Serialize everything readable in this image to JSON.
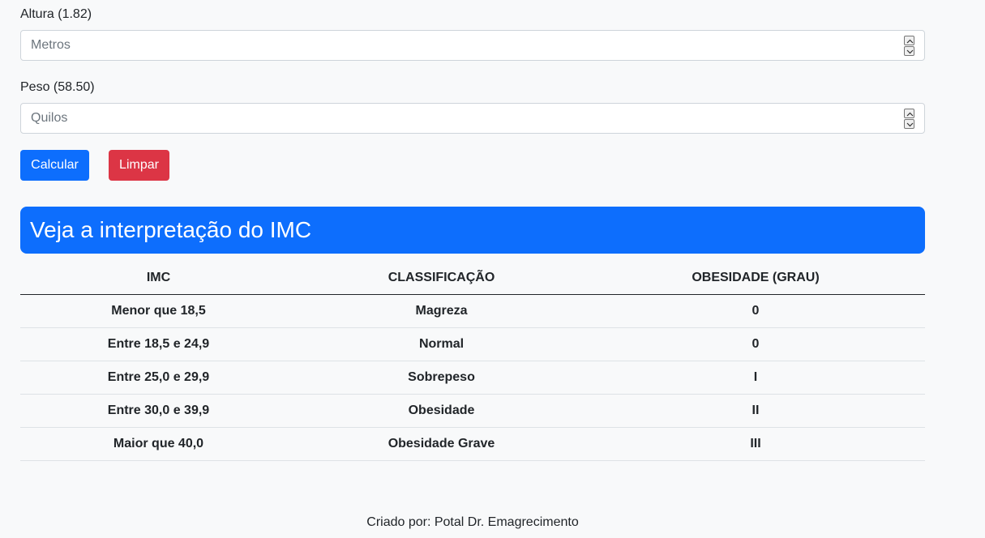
{
  "form": {
    "altura_label": "Altura (1.82)",
    "altura_placeholder": "Metros",
    "peso_label": "Peso (58.50)",
    "peso_placeholder": "Quilos",
    "calcular_label": "Calcular",
    "limpar_label": "Limpar"
  },
  "banner": {
    "title": "Veja a interpretação do IMC"
  },
  "table": {
    "headers": [
      "IMC",
      "CLASSIFICAÇÃO",
      "OBESIDADE (GRAU)"
    ],
    "rows": [
      [
        "Menor que 18,5",
        "Magreza",
        "0"
      ],
      [
        "Entre 18,5 e 24,9",
        "Normal",
        "0"
      ],
      [
        "Entre 25,0 e 29,9",
        "Sobrepeso",
        "I"
      ],
      [
        "Entre 30,0 e 39,9",
        "Obesidade",
        "II"
      ],
      [
        "Maior que 40,0",
        "Obesidade Grave",
        "III"
      ]
    ]
  },
  "footer": {
    "text": "Criado por: Potal Dr. Emagrecimento"
  },
  "colors": {
    "primary": "#0d6efd",
    "danger": "#dc3545",
    "background": "#f8f9fa"
  }
}
